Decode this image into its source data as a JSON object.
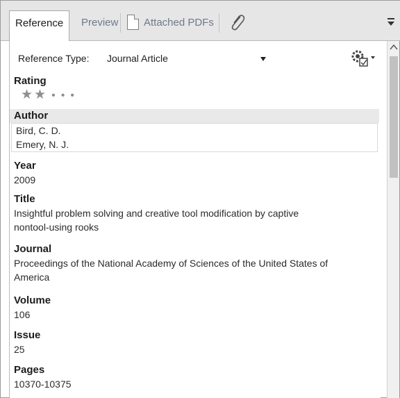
{
  "tabs": [
    {
      "label": "Reference",
      "active": true
    },
    {
      "label": "Preview",
      "active": false
    },
    {
      "label": "Attached PDFs",
      "active": false
    }
  ],
  "icons": {
    "attached_pdfs": "document-icon",
    "attach": "paperclip-icon",
    "overflow": "triangle-down-icon",
    "settings": "gear-checklist-icon"
  },
  "reference_type": {
    "label": "Reference Type:",
    "value": "Journal Article"
  },
  "rating": {
    "label": "Rating",
    "stars_filled": 2,
    "stars_total": 5,
    "filled_glyph": "★",
    "empty_glyph": "•"
  },
  "fields": {
    "author": {
      "label": "Author",
      "values": [
        "Bird, C. D.",
        "Emery, N. J."
      ]
    },
    "year": {
      "label": "Year",
      "value": "2009"
    },
    "title": {
      "label": "Title",
      "line1": "Insightful problem solving and creative tool modification by captive",
      "line2": "nontool-using rooks"
    },
    "journal": {
      "label": "Journal",
      "line1": "Proceedings of the National Academy of Sciences of the United States of",
      "line2": "America"
    },
    "volume": {
      "label": "Volume",
      "value": "106"
    },
    "issue": {
      "label": "Issue",
      "value": "25"
    },
    "pages": {
      "label": "Pages",
      "value": "10370-10375"
    }
  },
  "colors": {
    "tab_bar": "#e6e6e6",
    "inactive_tab_text": "#6d7a8a",
    "highlight_row": "#e9e9e9"
  }
}
